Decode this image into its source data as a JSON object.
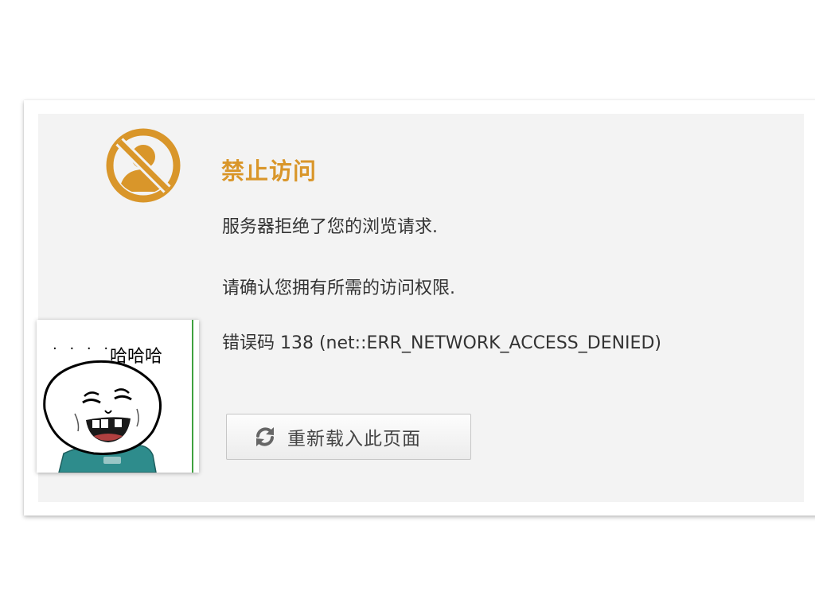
{
  "error_page": {
    "title": "禁止访问",
    "message_line_1": "服务器拒绝了您的浏览请求.",
    "message_line_2": "请确认您拥有所需的访问权限.",
    "error_code_line": "错误码 138 (net::ERR_NETWORK_ACCESS_DENIED)",
    "icon": "forbidden-user-icon",
    "accent_color": "#d9962a"
  },
  "reload_button": {
    "label": "重新载入此页面",
    "icon": "refresh-icon"
  },
  "meme_sticker": {
    "dots": "· · · ·",
    "caption": "哈哈哈"
  }
}
